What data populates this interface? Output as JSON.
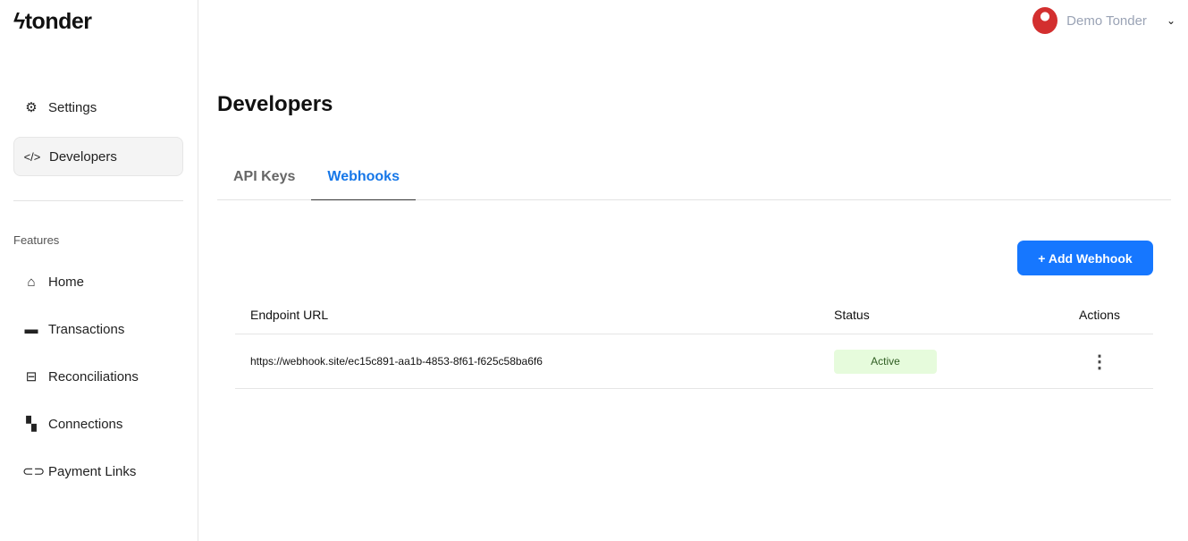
{
  "brand": "tonder",
  "user": {
    "name": "Demo Tonder"
  },
  "sidebar": {
    "top": [
      {
        "label": "Settings",
        "icon": "gear-icon"
      },
      {
        "label": "Developers",
        "icon": "code-icon"
      }
    ],
    "section": "Features",
    "features": [
      {
        "label": "Home"
      },
      {
        "label": "Transactions"
      },
      {
        "label": "Reconciliations"
      },
      {
        "label": "Connections"
      },
      {
        "label": "Payment Links"
      }
    ]
  },
  "page": {
    "title": "Developers",
    "tabs": [
      "API Keys",
      "Webhooks"
    ],
    "add_label": "+ Add Webhook"
  },
  "table": {
    "headers": [
      "Endpoint URL",
      "Status",
      "Actions"
    ],
    "rows": [
      {
        "url": "https://webhook.site/ec15c891-aa1b-4853-8f61-f625c58ba6f6",
        "status": "Active"
      }
    ]
  }
}
